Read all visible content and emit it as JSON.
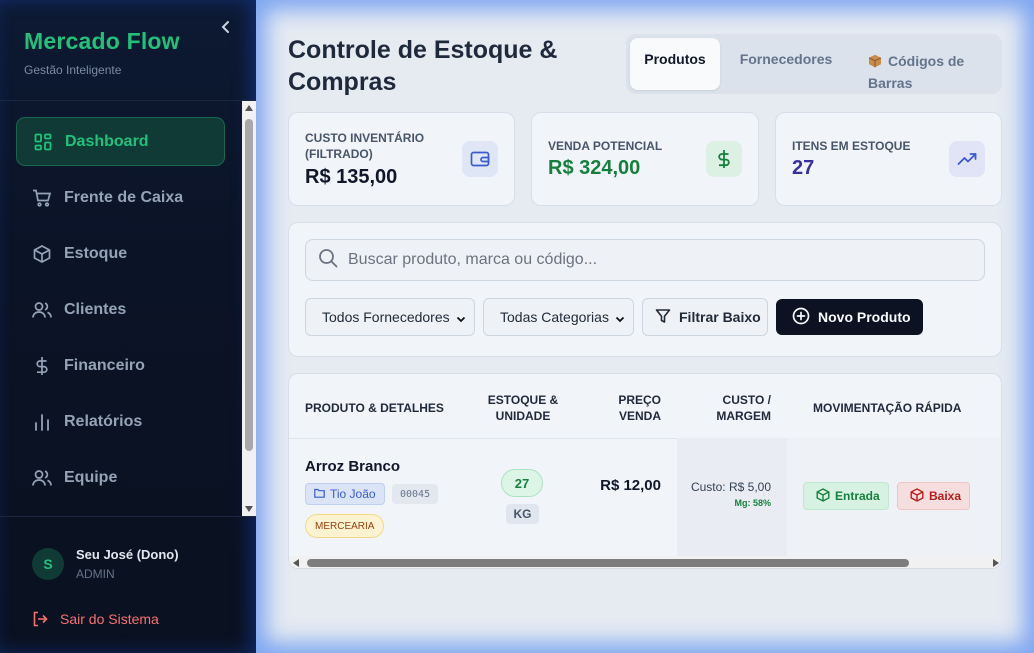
{
  "sidebar": {
    "brand_title": "Mercado Flow",
    "brand_subtitle": "Gestão Inteligente",
    "collapse_icon": "chevron-left-icon",
    "items": [
      {
        "label": "Dashboard",
        "icon": "dashboard-icon",
        "active": true
      },
      {
        "label": "Frente de Caixa",
        "icon": "cart-icon",
        "active": false
      },
      {
        "label": "Estoque",
        "icon": "box-icon",
        "active": false
      },
      {
        "label": "Clientes",
        "icon": "users-icon",
        "active": false
      },
      {
        "label": "Financeiro",
        "icon": "dollar-icon",
        "active": false
      },
      {
        "label": "Relatórios",
        "icon": "bar-chart-icon",
        "active": false
      },
      {
        "label": "Equipe",
        "icon": "team-icon",
        "active": false
      }
    ],
    "user": {
      "initial": "S",
      "name": "Seu José (Dono)",
      "role": "ADMIN"
    },
    "logout_label": "Sair do Sistema"
  },
  "header": {
    "title": "Controle de Estoque & Compras",
    "tabs": [
      {
        "label": "Produtos",
        "active": true
      },
      {
        "label": "Fornecedores",
        "active": false
      },
      {
        "label": "Códigos de Barras",
        "icon": "package-icon",
        "active": false
      }
    ]
  },
  "stats": [
    {
      "label": "CUSTO INVENTÁRIO (FILTRADO)",
      "value": "R$ 135,00",
      "icon": "wallet-icon",
      "color": "#0f172a"
    },
    {
      "label": "VENDA POTENCIAL",
      "value": "R$ 324,00",
      "icon": "dollar-icon",
      "color": "#15803d"
    },
    {
      "label": "ITENS EM ESTOQUE",
      "value": "27",
      "icon": "trending-up-icon",
      "color": "#3730a3"
    }
  ],
  "filters": {
    "search_placeholder": "Buscar produto, marca ou código...",
    "supplier_select": "Todos Fornecedores",
    "category_select": "Todas Categorias",
    "filter_low_label": "Filtrar Baixo",
    "new_product_label": "Novo Produto"
  },
  "table": {
    "headers": {
      "product": "PRODUTO & DETALHES",
      "stock": "ESTOQUE & UNIDADE",
      "price": "PREÇO VENDA",
      "cost": "CUSTO / MARGEM",
      "movement": "MOVIMENTAÇÃO RÁPIDA"
    },
    "rows": [
      {
        "name": "Arroz Branco",
        "supplier": "Tio João",
        "code": "00045",
        "category": "MERCEARIA",
        "stock": "27",
        "unit": "KG",
        "price": "R$ 12,00",
        "cost": "Custo: R$ 5,00",
        "margin": "Mg: 58%",
        "entry_label": "Entrada",
        "exit_label": "Baixa"
      }
    ]
  }
}
